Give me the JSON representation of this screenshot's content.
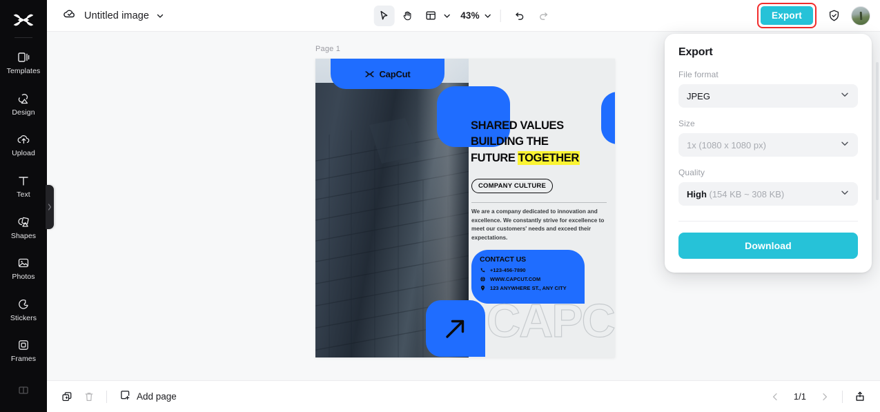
{
  "sidebar": {
    "logo_icon": "capcut-logo-icon",
    "items": [
      {
        "label": "Templates",
        "icon": "templates-icon"
      },
      {
        "label": "Design",
        "icon": "design-icon"
      },
      {
        "label": "Upload",
        "icon": "upload-cloud-icon"
      },
      {
        "label": "Text",
        "icon": "text-icon"
      },
      {
        "label": "Shapes",
        "icon": "shapes-icon"
      },
      {
        "label": "Photos",
        "icon": "photos-icon"
      },
      {
        "label": "Stickers",
        "icon": "stickers-icon"
      },
      {
        "label": "Frames",
        "icon": "frames-icon"
      },
      {
        "label": "",
        "icon": "more-icon"
      }
    ]
  },
  "topbar": {
    "cloud_icon": "cloud-saved-icon",
    "doc_title": "Untitled image",
    "title_chevron_icon": "chevron-down-icon",
    "tools": [
      {
        "name": "select-tool",
        "icon": "cursor-arrow-icon"
      },
      {
        "name": "hand-tool",
        "icon": "hand-icon"
      },
      {
        "name": "layout-tool",
        "icon": "layout-panels-icon"
      }
    ],
    "zoom_level": "43%",
    "zoom_chevron_icon": "chevron-down-icon",
    "undo_icon": "undo-arrow-icon",
    "redo_icon": "redo-arrow-icon",
    "export_label": "Export",
    "shield_icon": "shield-check-icon",
    "avatar_icon": "user-avatar",
    "highlight_color": "#f22b2b",
    "accent_color": "#26c2d8"
  },
  "canvas": {
    "page_label": "Page 1",
    "design": {
      "brand_pill": "CapCut",
      "brand_icon": "capcut-logo-icon",
      "headline_line1": "SHARED VALUES",
      "headline_line2": "BUILDING THE",
      "headline_line3_plain": "FUTURE ",
      "headline_line3_highlight": "TOGETHER",
      "badge": "COMPANY CULTURE",
      "body": "We are a company dedicated to innovation and excellence. We constantly strive for excellence to meet our customers' needs and exceed their expectations.",
      "contact_title": "CONTACT US",
      "contacts": [
        {
          "icon": "phone-icon",
          "text": "+123-456-7890"
        },
        {
          "icon": "globe-icon",
          "text": "WWW.CAPCUT.COM"
        },
        {
          "icon": "pin-icon",
          "text": "123 ANYWHERE ST., ANY CITY"
        }
      ],
      "arrow_icon": "arrow-up-right-icon",
      "outline_word": "CAPCUT",
      "blue": "#1f6dff",
      "highlight_yellow": "#fbf432"
    }
  },
  "export_panel": {
    "title": "Export",
    "file_format_label": "File format",
    "file_format_value": "JPEG",
    "size_label": "Size",
    "size_value": "1x (1080 x 1080 px)",
    "quality_label": "Quality",
    "quality_value_strong": "High",
    "quality_value_muted": " (154 KB ~ 308 KB)",
    "download_label": "Download",
    "chevron_icon": "chevron-down-icon"
  },
  "bottombar": {
    "duplicate_icon": "duplicate-page-icon",
    "delete_icon": "trash-icon",
    "add_page_icon": "add-page-icon",
    "add_page_label": "Add page",
    "prev_icon": "chevron-left-icon",
    "page_indicator": "1/1",
    "next_icon": "chevron-right-icon",
    "export_bottom_icon": "export-box-icon"
  }
}
